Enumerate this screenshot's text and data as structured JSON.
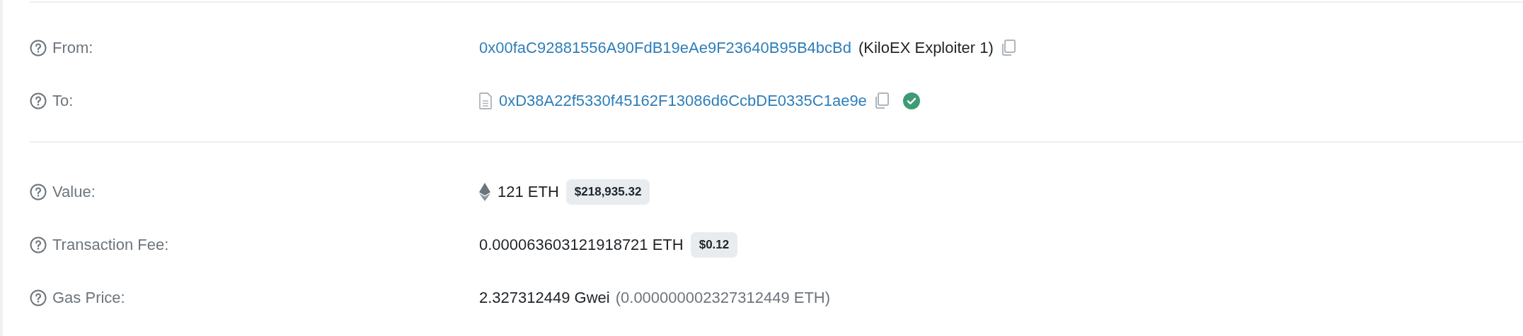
{
  "sections": [
    {
      "rows": [
        {
          "kind": "address",
          "label": "From:",
          "address": "0x00faC92881556A90FdB19eAe9F23640B95B4bcBd",
          "name": "(KiloEX Exploiter 1)",
          "contract": false,
          "verified": false
        },
        {
          "kind": "address",
          "label": "To:",
          "address": "0xD38A22f5330f45162F13086d6CcbDE0335C1ae9e",
          "contract": true,
          "verified": true
        }
      ]
    },
    {
      "rows": [
        {
          "kind": "eth",
          "label": "Value:",
          "amount": "121 ETH",
          "usd": "$218,935.32"
        },
        {
          "kind": "amount",
          "label": "Transaction Fee:",
          "amount": "0.000063603121918721 ETH",
          "usd": "$0.12"
        },
        {
          "kind": "gas",
          "label": "Gas Price:",
          "amount": "2.327312449 Gwei",
          "detail": "(0.000000002327312449 ETH)"
        }
      ]
    }
  ]
}
